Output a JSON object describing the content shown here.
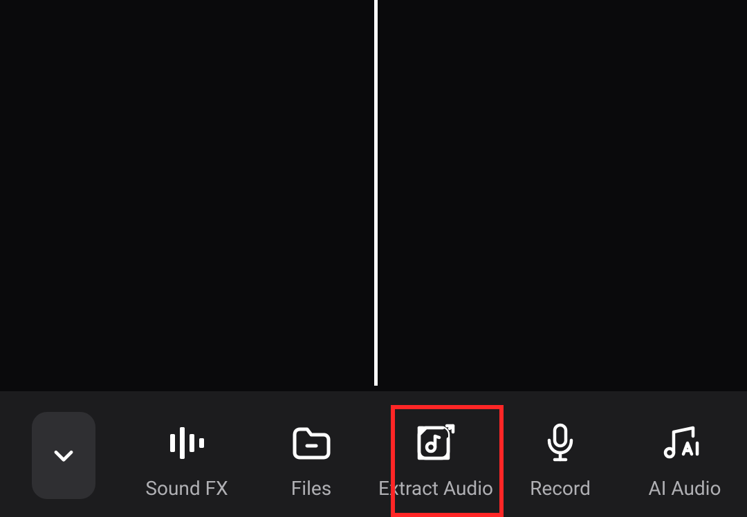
{
  "toolbar": {
    "items": [
      {
        "label": "Sound FX",
        "icon": "waveform-icon"
      },
      {
        "label": "Files",
        "icon": "folder-icon"
      },
      {
        "label": "Extract Audio",
        "icon": "extract-audio-icon",
        "highlighted": true
      },
      {
        "label": "Record",
        "icon": "microphone-icon"
      },
      {
        "label": "AI Audio",
        "icon": "ai-audio-icon"
      }
    ],
    "collapse_icon": "chevron-down-icon"
  },
  "timeline": {
    "playhead_visible": true
  },
  "colors": {
    "highlight": "#ff2626",
    "background": "#0a0a0c",
    "toolbar_bg": "#1c1c1e",
    "icon": "#ffffff",
    "label": "#b0b0b4"
  }
}
